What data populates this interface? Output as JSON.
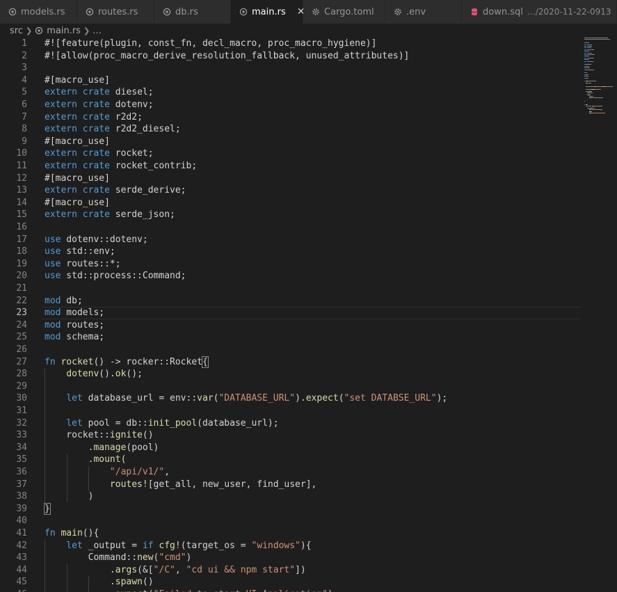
{
  "tabs": [
    {
      "label": "models.rs",
      "icon": "rust-icon",
      "active": false
    },
    {
      "label": "routes.rs",
      "icon": "rust-icon",
      "active": false
    },
    {
      "label": "db.rs",
      "icon": "rust-icon",
      "active": false
    },
    {
      "label": "main.rs",
      "icon": "rust-icon",
      "active": true
    },
    {
      "label": "Cargo.toml",
      "icon": "gear-icon",
      "active": false
    },
    {
      "label": ".env",
      "icon": "gear-icon",
      "active": false
    },
    {
      "label": "down.sql",
      "icon": "database-icon",
      "active": false,
      "description": "…/2020-11-22-0913"
    }
  ],
  "breadcrumb": {
    "folder": "src",
    "file": "main.rs",
    "more": "…"
  },
  "colors": {
    "keyword": "#569cd6",
    "function": "#dcdcaa",
    "string": "#ce9178",
    "text": "#d4d4d4",
    "line_number": "#858585",
    "background": "#1e1e1e"
  },
  "editor": {
    "current_line": 23,
    "lines": [
      {
        "n": "1",
        "tokens": [
          [
            "id",
            "#![feature(plugin, const_fn, decl_macro, proc_macro_hygiene)]"
          ]
        ]
      },
      {
        "n": "2",
        "tokens": [
          [
            "id",
            "#![allow(proc_macro_derive_resolution_fallback, unused_attributes)]"
          ]
        ]
      },
      {
        "n": "3",
        "tokens": []
      },
      {
        "n": "4",
        "tokens": [
          [
            "id",
            "#[macro_use]"
          ]
        ]
      },
      {
        "n": "5",
        "tokens": [
          [
            "kw",
            "extern"
          ],
          [
            "id",
            " "
          ],
          [
            "kw",
            "crate"
          ],
          [
            "id",
            " diesel;"
          ]
        ]
      },
      {
        "n": "6",
        "tokens": [
          [
            "kw",
            "extern"
          ],
          [
            "id",
            " "
          ],
          [
            "kw",
            "crate"
          ],
          [
            "id",
            " dotenv;"
          ]
        ]
      },
      {
        "n": "7",
        "tokens": [
          [
            "kw",
            "extern"
          ],
          [
            "id",
            " "
          ],
          [
            "kw",
            "crate"
          ],
          [
            "id",
            " r2d2;"
          ]
        ]
      },
      {
        "n": "8",
        "tokens": [
          [
            "kw",
            "extern"
          ],
          [
            "id",
            " "
          ],
          [
            "kw",
            "crate"
          ],
          [
            "id",
            " r2d2_diesel;"
          ]
        ]
      },
      {
        "n": "9",
        "tokens": [
          [
            "id",
            "#[macro_use]"
          ]
        ]
      },
      {
        "n": "10",
        "tokens": [
          [
            "kw",
            "extern"
          ],
          [
            "id",
            " "
          ],
          [
            "kw",
            "crate"
          ],
          [
            "id",
            " rocket;"
          ]
        ]
      },
      {
        "n": "11",
        "tokens": [
          [
            "kw",
            "extern"
          ],
          [
            "id",
            " "
          ],
          [
            "kw",
            "crate"
          ],
          [
            "id",
            " rocket_contrib;"
          ]
        ]
      },
      {
        "n": "12",
        "tokens": [
          [
            "id",
            "#[macro_use]"
          ]
        ]
      },
      {
        "n": "13",
        "tokens": [
          [
            "kw",
            "extern"
          ],
          [
            "id",
            " "
          ],
          [
            "kw",
            "crate"
          ],
          [
            "id",
            " serde_derive;"
          ]
        ]
      },
      {
        "n": "14",
        "tokens": [
          [
            "id",
            "#[macro_use]"
          ]
        ]
      },
      {
        "n": "15",
        "tokens": [
          [
            "kw",
            "extern"
          ],
          [
            "id",
            " "
          ],
          [
            "kw",
            "crate"
          ],
          [
            "id",
            " serde_json;"
          ]
        ]
      },
      {
        "n": "16",
        "tokens": []
      },
      {
        "n": "17",
        "tokens": [
          [
            "kw",
            "use"
          ],
          [
            "id",
            " dotenv::dotenv;"
          ]
        ]
      },
      {
        "n": "18",
        "tokens": [
          [
            "kw",
            "use"
          ],
          [
            "id",
            " std::env;"
          ]
        ]
      },
      {
        "n": "19",
        "tokens": [
          [
            "kw",
            "use"
          ],
          [
            "id",
            " routes::*;"
          ]
        ]
      },
      {
        "n": "20",
        "tokens": [
          [
            "kw",
            "use"
          ],
          [
            "id",
            " std::process::Command;"
          ]
        ]
      },
      {
        "n": "21",
        "tokens": []
      },
      {
        "n": "22",
        "tokens": [
          [
            "kw",
            "mod"
          ],
          [
            "id",
            " db;"
          ]
        ]
      },
      {
        "n": "23",
        "tokens": [
          [
            "kw",
            "mod"
          ],
          [
            "id",
            " models;"
          ]
        ]
      },
      {
        "n": "24",
        "tokens": [
          [
            "kw",
            "mod"
          ],
          [
            "id",
            " routes;"
          ]
        ]
      },
      {
        "n": "25",
        "tokens": [
          [
            "kw",
            "mod"
          ],
          [
            "id",
            " schema;"
          ]
        ]
      },
      {
        "n": "26",
        "tokens": []
      },
      {
        "n": "27",
        "tokens": [
          [
            "kw",
            "fn"
          ],
          [
            "id",
            " "
          ],
          [
            "fn",
            "rocket"
          ],
          [
            "id",
            "() -> rocker::Rocket"
          ],
          [
            "br",
            "{"
          ]
        ]
      },
      {
        "n": "28",
        "tokens": [
          [
            "id",
            "    "
          ],
          [
            "fn",
            "dotenv"
          ],
          [
            "id",
            "()."
          ],
          [
            "fn",
            "ok"
          ],
          [
            "id",
            "();"
          ]
        ]
      },
      {
        "n": "29",
        "tokens": []
      },
      {
        "n": "30",
        "tokens": [
          [
            "id",
            "    "
          ],
          [
            "kw",
            "let"
          ],
          [
            "id",
            " database_url = env::"
          ],
          [
            "fn",
            "var"
          ],
          [
            "id",
            "("
          ],
          [
            "str",
            "\"DATABASE_URL\""
          ],
          [
            "id",
            ")."
          ],
          [
            "fn",
            "expect"
          ],
          [
            "id",
            "("
          ],
          [
            "str",
            "\"set DATABSE_URL\""
          ],
          [
            "id",
            ");"
          ]
        ]
      },
      {
        "n": "31",
        "tokens": []
      },
      {
        "n": "32",
        "tokens": [
          [
            "id",
            "    "
          ],
          [
            "kw",
            "let"
          ],
          [
            "id",
            " pool = db::"
          ],
          [
            "fn",
            "init_pool"
          ],
          [
            "id",
            "(database_url);"
          ]
        ]
      },
      {
        "n": "33",
        "tokens": [
          [
            "id",
            "    rocket::"
          ],
          [
            "fn",
            "ignite"
          ],
          [
            "id",
            "()"
          ]
        ]
      },
      {
        "n": "34",
        "tokens": [
          [
            "id",
            "        ."
          ],
          [
            "fn",
            "manage"
          ],
          [
            "id",
            "(pool)"
          ]
        ]
      },
      {
        "n": "35",
        "tokens": [
          [
            "id",
            "        ."
          ],
          [
            "fn",
            "mount"
          ],
          [
            "id",
            "("
          ]
        ]
      },
      {
        "n": "36",
        "tokens": [
          [
            "id",
            "            "
          ],
          [
            "str",
            "\"/api/v1/\""
          ],
          [
            "id",
            ","
          ]
        ]
      },
      {
        "n": "37",
        "tokens": [
          [
            "id",
            "            "
          ],
          [
            "fn",
            "routes!"
          ],
          [
            "id",
            "[get_all, new_user, find_user],"
          ]
        ]
      },
      {
        "n": "38",
        "tokens": [
          [
            "id",
            "        )"
          ]
        ]
      },
      {
        "n": "39",
        "tokens": [
          [
            "br",
            "}"
          ]
        ]
      },
      {
        "n": "40",
        "tokens": []
      },
      {
        "n": "41",
        "tokens": [
          [
            "kw",
            "fn"
          ],
          [
            "id",
            " "
          ],
          [
            "fn",
            "main"
          ],
          [
            "id",
            "(){"
          ]
        ]
      },
      {
        "n": "42",
        "tokens": [
          [
            "id",
            "    "
          ],
          [
            "kw",
            "let"
          ],
          [
            "id",
            " _output = "
          ],
          [
            "kw",
            "if"
          ],
          [
            "id",
            " "
          ],
          [
            "fn",
            "cfg!"
          ],
          [
            "id",
            "(target_os = "
          ],
          [
            "str",
            "\"windows\""
          ],
          [
            "id",
            "){"
          ]
        ]
      },
      {
        "n": "43",
        "tokens": [
          [
            "id",
            "        Command::"
          ],
          [
            "fn",
            "new"
          ],
          [
            "id",
            "("
          ],
          [
            "str",
            "\"cmd\""
          ],
          [
            "id",
            ")"
          ]
        ]
      },
      {
        "n": "44",
        "tokens": [
          [
            "id",
            "            ."
          ],
          [
            "fn",
            "args"
          ],
          [
            "id",
            "(&["
          ],
          [
            "str",
            "\"/C\""
          ],
          [
            "id",
            ", "
          ],
          [
            "str",
            "\"cd ui && npm start\""
          ],
          [
            "id",
            "])"
          ]
        ]
      },
      {
        "n": "45",
        "tokens": [
          [
            "id",
            "            ."
          ],
          [
            "fn",
            "spawn"
          ],
          [
            "id",
            "()"
          ]
        ]
      },
      {
        "n": "46",
        "tokens": [
          [
            "id",
            "            ."
          ],
          [
            "fn",
            "expect"
          ],
          [
            "id",
            "("
          ],
          [
            "str",
            "\"Failed to start UI Application\""
          ],
          [
            "id",
            ")"
          ]
        ]
      }
    ]
  }
}
